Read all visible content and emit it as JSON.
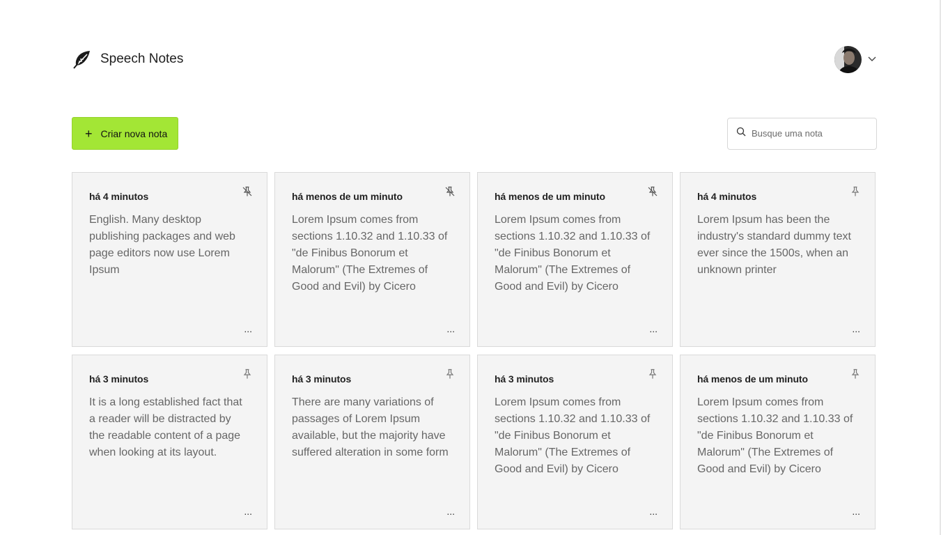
{
  "app": {
    "title": "Speech Notes"
  },
  "toolbar": {
    "new_note_label": "Criar nova nota",
    "search_placeholder": "Busque uma nota"
  },
  "notes": [
    {
      "time": "há 4 minutos",
      "text": "English. Many desktop publishing packages and web page editors now use Lorem Ipsum",
      "pinned": true
    },
    {
      "time": "há menos de um minuto",
      "text": "Lorem Ipsum comes from sections 1.10.32 and 1.10.33 of \"de Finibus Bonorum et Malorum\" (The Extremes of Good and Evil) by Cicero",
      "pinned": true
    },
    {
      "time": "há menos de um minuto",
      "text": "Lorem Ipsum comes from sections 1.10.32 and 1.10.33 of \"de Finibus Bonorum et Malorum\" (The Extremes of Good and Evil) by Cicero",
      "pinned": true
    },
    {
      "time": "há 4 minutos",
      "text": "Lorem Ipsum has been the industry's standard dummy text ever since the 1500s, when an unknown printer",
      "pinned": false
    },
    {
      "time": "há 3 minutos",
      "text": "It is a long established fact that a reader will be distracted by the readable content of a page when looking at its layout.",
      "pinned": false
    },
    {
      "time": "há 3 minutos",
      "text": "There are many variations of passages of Lorem Ipsum available, but the majority have suffered alteration in some form",
      "pinned": false
    },
    {
      "time": "há 3 minutos",
      "text": "Lorem Ipsum comes from sections 1.10.32 and 1.10.33 of \"de Finibus Bonorum et Malorum\" (The Extremes of Good and Evil) by Cicero",
      "pinned": false
    },
    {
      "time": "há menos de um minuto",
      "text": "Lorem Ipsum comes from sections 1.10.32 and 1.10.33 of \"de Finibus Bonorum et Malorum\" (The Extremes of Good and Evil) by Cicero",
      "pinned": false
    }
  ],
  "card_menu_label": "...",
  "icons": {
    "logo": "feather-leaf-icon",
    "pinned": "pin-off-icon",
    "unpinned": "pin-icon",
    "search": "search-icon",
    "user_menu": "chevron-down-icon"
  },
  "colors": {
    "accent": "#a3e635",
    "card_bg": "#f4f4f4"
  }
}
